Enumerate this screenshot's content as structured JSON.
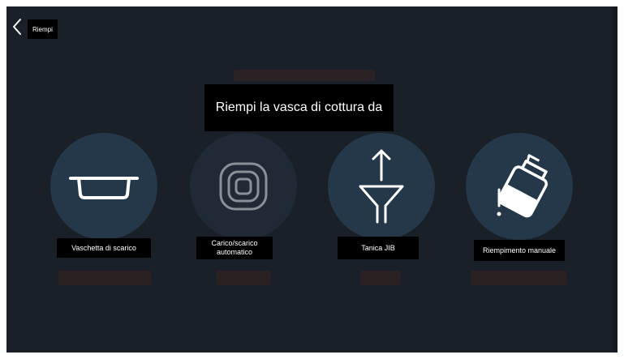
{
  "header": {
    "back_icon": "chevron-left-icon",
    "title": "Riempi"
  },
  "main": {
    "heading": "Riempi la vasca di cottura da",
    "options": [
      {
        "label": "Vaschetta di scarico",
        "icon": "tray-icon",
        "enabled": true
      },
      {
        "label_line1": "Carico/scarico",
        "label_line2": "automatico",
        "icon": "auto-load-icon",
        "enabled": false
      },
      {
        "label": "Tanica JIB",
        "icon": "funnel-arrow-icon",
        "enabled": true
      },
      {
        "label": "Riempimento manuale",
        "icon": "pitcher-pour-icon",
        "enabled": true
      }
    ]
  },
  "colors": {
    "background": "#1a2028",
    "circle": "#25384a",
    "circle_disabled": "#1f2a36",
    "label_bg": "#000000",
    "text": "#ffffff"
  }
}
